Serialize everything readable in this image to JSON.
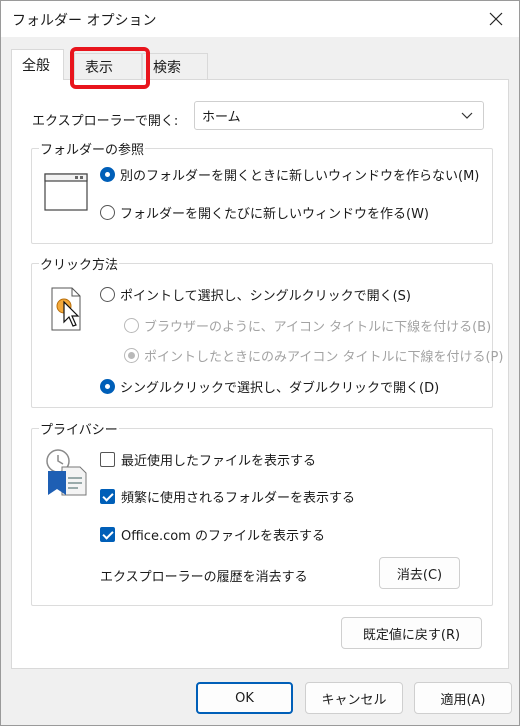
{
  "window": {
    "title": "フォルダー オプション"
  },
  "tabs": [
    {
      "label": "全般"
    },
    {
      "label": "表示"
    },
    {
      "label": "検索"
    }
  ],
  "general": {
    "open_explorer_label": "エクスプローラーで開く:",
    "open_explorer_value": "ホーム",
    "browse_folders": {
      "label": "フォルダーの参照",
      "options": [
        {
          "label": "別のフォルダーを開くときに新しいウィンドウを作らない(M)",
          "selected": true
        },
        {
          "label": "フォルダーを開くたびに新しいウィンドウを作る(W)",
          "selected": false
        }
      ]
    },
    "click_items": {
      "label": "クリック方法",
      "single_click": "ポイントして選択し、シングルクリックで開く(S)",
      "underline_browser": "ブラウザーのように、アイコン タイトルに下線を付ける(B)",
      "underline_point": "ポイントしたときにのみアイコン タイトルに下線を付ける(P)",
      "double_click": "シングルクリックで選択し、ダブルクリックで開く(D)"
    },
    "privacy": {
      "label": "プライバシー",
      "recent_files": "最近使用したファイルを表示する",
      "frequent_folders": "頻繁に使用されるフォルダーを表示する",
      "office_files": "Office.com のファイルを表示する",
      "clear_history_label": "エクスプローラーの履歴を消去する",
      "clear_button": "消去(C)"
    },
    "restore_defaults": "既定値に戻す(R)"
  },
  "footer": {
    "ok": "OK",
    "cancel": "キャンセル",
    "apply": "適用(A)"
  },
  "colors": {
    "accent": "#005fb8",
    "highlight": "#e8141c"
  }
}
